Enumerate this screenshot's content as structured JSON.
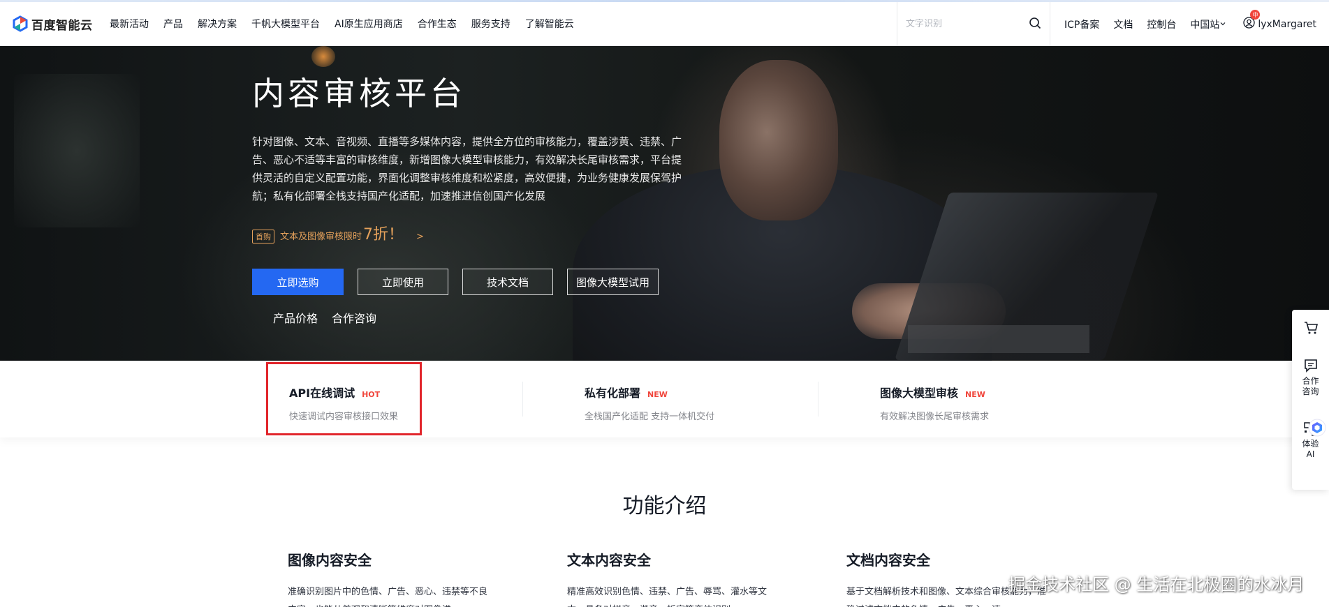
{
  "brand": {
    "name": "百度智能云",
    "primary_color": "#2468f2",
    "promo_color": "#e5a15b",
    "hot_color": "#f0463c"
  },
  "nav": {
    "items": [
      "最新活动",
      "产品",
      "解决方案",
      "千帆大模型平台",
      "AI原生应用商店",
      "合作生态",
      "服务支持",
      "了解智能云"
    ],
    "search_placeholder": "文字识别",
    "links": {
      "icp": "ICP备案",
      "docs": "文档",
      "console": "控制台",
      "region": "中国站"
    },
    "user": {
      "name": "lyxMargaret",
      "badge": "中"
    }
  },
  "hero": {
    "title": "内容审核平台",
    "description": "针对图像、文本、音视频、直播等多媒体内容，提供全方位的审核能力，覆盖涉黄、违禁、广告、恶心不适等丰富的审核维度，新增图像大模型审核能力，有效解决长尾审核需求，平台提供灵活的自定义配置功能，界面化调整审核维度和松紧度，高效便捷，为业务健康发展保驾护航；私有化部署全栈支持国产化适配，加速推进信创国产化发展",
    "promo": {
      "tag": "首购",
      "text": "文本及图像审核限时",
      "highlight": "7折！",
      "arrow": ">"
    },
    "buttons": {
      "buy": "立即选购",
      "use": "立即使用",
      "docs": "技术文档",
      "trial": "图像大模型试用"
    },
    "links": {
      "price": "产品价格",
      "consult": "合作咨询"
    }
  },
  "cards": [
    {
      "title": "API在线调试",
      "tag": "HOT",
      "subtitle": "快速调试内容审核接口效果"
    },
    {
      "title": "私有化部署",
      "tag": "NEW",
      "subtitle": "全栈国产化适配 支持一体机交付"
    },
    {
      "title": "图像大模型审核",
      "tag": "NEW",
      "subtitle": "有效解决图像长尾审核需求"
    }
  ],
  "features": {
    "section_title": "功能介绍",
    "items": [
      {
        "title": "图像内容安全",
        "desc": "准确识别图片中的色情、广告、恶心、违禁等不良内容，也能从美观和清晰等维度对图像进"
      },
      {
        "title": "文本内容安全",
        "desc": "精准高效识别色情、违禁、广告、辱骂、灌水等文本，具备对拼音、谐音、拆字等变体识别"
      },
      {
        "title": "文档内容安全",
        "desc": "基于文档解析技术和图像、文本综合审核能力，准确过滤文档中的色情、广告、恶心、违"
      }
    ]
  },
  "float_bar": {
    "consult": [
      "合作",
      "咨询"
    ],
    "ai": [
      "体验",
      "AI"
    ]
  },
  "watermark": "掘金技术社区 @ 生活在北极圈的水冰月"
}
